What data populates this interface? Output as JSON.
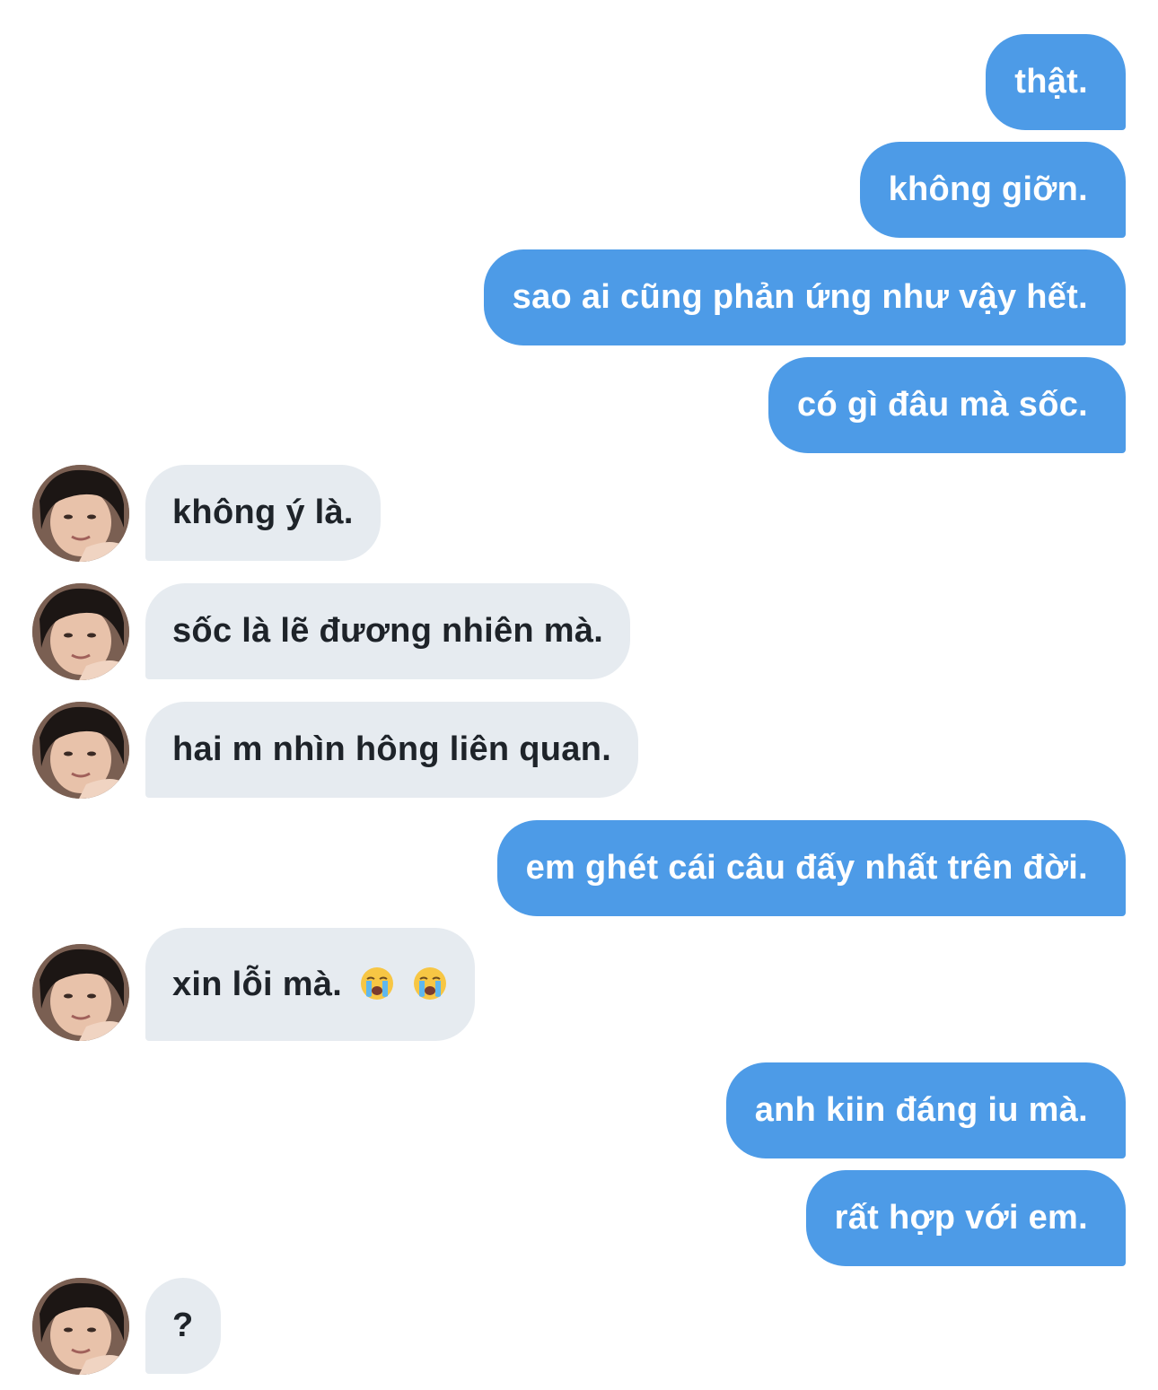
{
  "conversation": {
    "messages": [
      {
        "id": "m1",
        "side": "out",
        "text": "thật."
      },
      {
        "id": "m2",
        "side": "out",
        "text": "không giỡn."
      },
      {
        "id": "m3",
        "side": "out",
        "text": "sao ai cũng phản ứng như vậy hết."
      },
      {
        "id": "m4",
        "side": "out",
        "text": "có gì đâu mà sốc."
      },
      {
        "id": "m5",
        "side": "in",
        "text": "không ý là."
      },
      {
        "id": "m6",
        "side": "in",
        "text": "sốc là lẽ đương nhiên mà."
      },
      {
        "id": "m7",
        "side": "in",
        "text": "hai m nhìn hông liên quan."
      },
      {
        "id": "m8",
        "side": "out",
        "text": "em ghét cái câu đấy nhất trên đời."
      },
      {
        "id": "m9",
        "side": "in",
        "text": "xin lỗi mà.",
        "emojis": [
          "loudly-crying-face-icon",
          "loudly-crying-face-icon"
        ]
      },
      {
        "id": "m10",
        "side": "out",
        "text": "anh kiin đáng iu mà."
      },
      {
        "id": "m11",
        "side": "out",
        "text": "rất hợp với em."
      },
      {
        "id": "m12",
        "side": "in",
        "text": "?"
      }
    ]
  },
  "colors": {
    "outgoing_bubble": "#4d9be7",
    "incoming_bubble": "#e6ebf0",
    "outgoing_text": "#ffffff",
    "incoming_text": "#1e2329"
  },
  "icons": {
    "avatar": "contact-avatar-photo",
    "emoji": "loudly-crying-face-icon"
  }
}
